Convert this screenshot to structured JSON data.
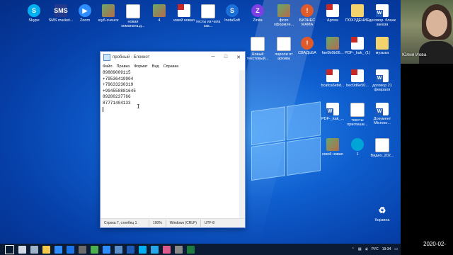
{
  "desktop_icons": [
    {
      "label": "Skype",
      "kind": "skype",
      "glyph": "S"
    },
    {
      "label": "SMS market...",
      "kind": "sms",
      "glyph": "SMS"
    },
    {
      "label": "Zoom",
      "kind": "zoom",
      "glyph": "▶"
    },
    {
      "label": "юуб-эченск",
      "kind": "photo",
      "glyph": ""
    },
    {
      "label": "новая команата.д...",
      "kind": "doc",
      "glyph": ""
    },
    {
      "label": "4",
      "kind": "photo",
      "glyph": ""
    },
    {
      "label": "ювей новая",
      "kind": "pdf",
      "glyph": ""
    },
    {
      "label": "тесты из чата зак...",
      "kind": "doc",
      "glyph": ""
    },
    {
      "label": "InstaSoft",
      "kind": "insta",
      "glyph": "S"
    },
    {
      "label": "Zinita",
      "kind": "purple",
      "glyph": "Z"
    },
    {
      "label": "фото оформле...",
      "kind": "photo",
      "glyph": ""
    },
    {
      "label": "БИЗНЕС МАМА",
      "kind": "red",
      "glyph": "!"
    },
    {
      "label": "Артем",
      "kind": "pdf",
      "glyph": ""
    },
    {
      "label": "ПОХУДЕНИЕ",
      "kind": "zip",
      "glyph": ""
    },
    {
      "label": "договор. бланк заказа",
      "kind": "word",
      "glyph": ""
    },
    {
      "label": "Новый текстовый...",
      "kind": "doc",
      "glyph": ""
    },
    {
      "label": "пароли от архива",
      "kind": "doc",
      "glyph": ""
    },
    {
      "label": "СВАДЬБА",
      "kind": "red",
      "glyph": "!"
    },
    {
      "label": "fae0b0b06...",
      "kind": "photo",
      "glyph": ""
    },
    {
      "label": "PDF-_kak_ (1)",
      "kind": "pdf",
      "glyph": ""
    },
    {
      "label": "музыка",
      "kind": "zip",
      "glyph": ""
    },
    {
      "label": "bcafca6ebd...",
      "kind": "pdf",
      "glyph": ""
    },
    {
      "label": "bec0d6e50...",
      "kind": "pdf",
      "glyph": ""
    },
    {
      "label": "договор 21 февраля",
      "kind": "word",
      "glyph": ""
    },
    {
      "label": "PDF-_kak_...",
      "kind": "word",
      "glyph": ""
    },
    {
      "label": "тексты приглаше...",
      "kind": "doc",
      "glyph": ""
    },
    {
      "label": "Документ Microso...",
      "kind": "word",
      "glyph": ""
    },
    {
      "label": "ювей новая",
      "kind": "photo",
      "glyph": ""
    },
    {
      "label": "1",
      "kind": "cyan",
      "glyph": ""
    },
    {
      "label": "Видео_202...",
      "kind": "doc",
      "glyph": "▶"
    },
    {
      "label": "Корзина",
      "kind": "recycle",
      "glyph": "♻"
    }
  ],
  "notepad": {
    "title": "пробный - Блокнот",
    "menu": [
      "Файл",
      "Правка",
      "Формат",
      "Вид",
      "Справка"
    ],
    "lines": [
      "89889009115",
      "+79536419904",
      "+79633230319",
      "+994558881645",
      "89280237766",
      "87771404133"
    ],
    "status": {
      "position": "Строка 7, столбец 1",
      "zoom": "100%",
      "eol": "Windows (CRLF)",
      "encoding": "UTF-8"
    },
    "controls": {
      "minimize": "─",
      "maximize": "□",
      "close": "✕"
    }
  },
  "taskbar": {
    "lang": "РУС",
    "time": "19:34",
    "apps": [
      "start",
      "search",
      "taskview",
      "explorer",
      "edge",
      "mail",
      "store",
      "chrome",
      "zoom",
      "notepad",
      "word",
      "skype",
      "telegram",
      "photos",
      "settings",
      "excel"
    ]
  },
  "webcam": {
    "name": "Юлия Иова"
  },
  "overlay_date": "2020-02-"
}
